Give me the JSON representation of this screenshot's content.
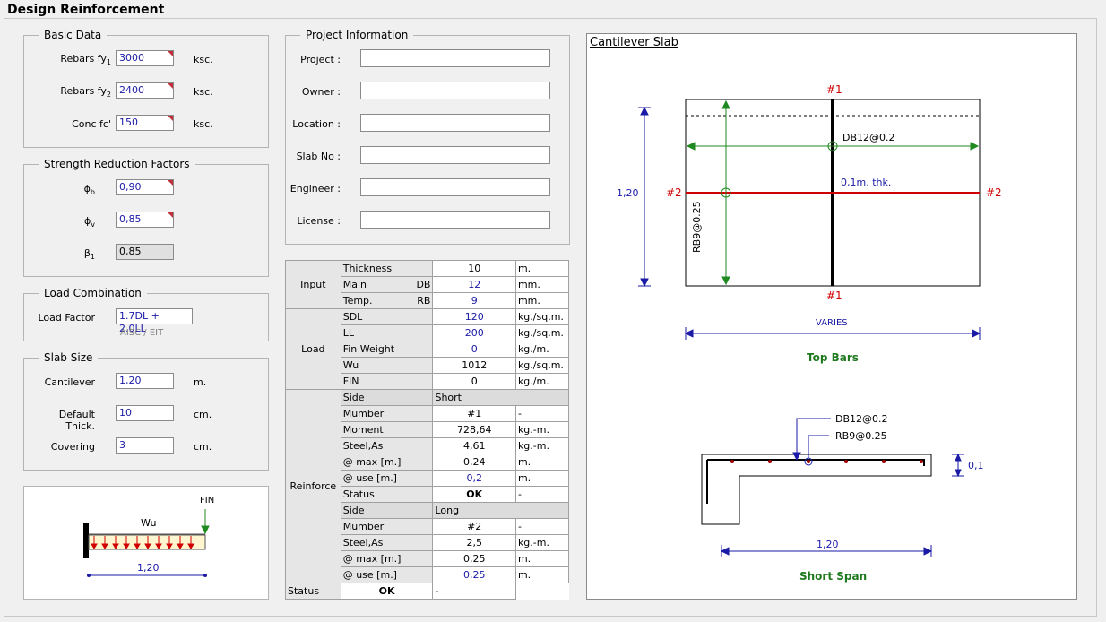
{
  "window_title": "Design Reinforcement",
  "basic_data": {
    "legend": "Basic Data",
    "rows": [
      {
        "label": "Rebars fy",
        "sub": "1",
        "value": "3000",
        "unit": "ksc."
      },
      {
        "label": "Rebars fy",
        "sub": "2",
        "value": "2400",
        "unit": "ksc."
      },
      {
        "label": "Conc fc'",
        "sub": "",
        "value": "150",
        "unit": "ksc."
      }
    ]
  },
  "strength": {
    "legend": "Strength Reduction Factors",
    "rows": [
      {
        "sym": "ϕ",
        "sub": "b",
        "value": "0,90"
      },
      {
        "sym": "ϕ",
        "sub": "v",
        "value": "0,85"
      },
      {
        "sym": "β",
        "sub": "1",
        "value": "0,85"
      }
    ]
  },
  "load_combination": {
    "legend": "Load Combination",
    "label": "Load Factor",
    "value": "1.7DL + 2.0LL",
    "note": "AISC / EIT"
  },
  "slab_size": {
    "legend": "Slab Size",
    "rows": [
      {
        "label": "Cantilever",
        "value": "1,20",
        "unit": "m."
      },
      {
        "label": "Default Thick.",
        "value": "10",
        "unit": "cm."
      },
      {
        "label": "Covering",
        "value": "3",
        "unit": "cm."
      }
    ]
  },
  "beam_sketch": {
    "load": "Wu",
    "point": "FIN",
    "span": "1,20"
  },
  "project": {
    "legend": "Project Information",
    "fields": [
      {
        "label": "Project :",
        "value": ""
      },
      {
        "label": "Owner :",
        "value": ""
      },
      {
        "label": "Location :",
        "value": ""
      },
      {
        "label": "Slab No :",
        "value": ""
      },
      {
        "label": "Engineer :",
        "value": ""
      },
      {
        "label": "License :",
        "value": ""
      }
    ]
  },
  "table": {
    "groups": {
      "input": "Input",
      "load": "Load",
      "reinforce": "Reinforce"
    },
    "input": [
      {
        "k": "Thickness",
        "k2": "",
        "v": "10",
        "u": "m.",
        "blue": false
      },
      {
        "k": "Main",
        "k2": "DB",
        "v": "12",
        "u": "mm.",
        "blue": true
      },
      {
        "k": "Temp.",
        "k2": "RB",
        "v": "9",
        "u": "mm.",
        "blue": true
      }
    ],
    "load": [
      {
        "k": "SDL",
        "v": "120",
        "u": "kg./sq.m.",
        "blue": true
      },
      {
        "k": "LL",
        "v": "200",
        "u": "kg./sq.m.",
        "blue": true
      },
      {
        "k": "Fin Weight",
        "v": "0",
        "u": "kg./m.",
        "blue": true
      },
      {
        "k": "Wu",
        "v": "1012",
        "u": "kg./sq.m.",
        "blue": false
      },
      {
        "k": "FIN",
        "v": "0",
        "u": "kg./m.",
        "blue": false
      }
    ],
    "short": {
      "side_label": "Side",
      "side_value": "Short",
      "rows": [
        {
          "k": "Mumber",
          "v": "#1",
          "u": "-",
          "blue": false,
          "bold": false
        },
        {
          "k": "Moment",
          "v": "728,64",
          "u": "kg.-m.",
          "blue": false,
          "bold": false
        },
        {
          "k": "Steel,As",
          "v": "4,61",
          "u": "kg.-m.",
          "blue": false,
          "bold": false
        },
        {
          "k": "@ max [m.]",
          "v": "0,24",
          "u": "m.",
          "blue": false,
          "bold": false
        },
        {
          "k": "@ use [m.]",
          "v": "0,2",
          "u": "m.",
          "blue": true,
          "bold": false
        },
        {
          "k": "Status",
          "v": "OK",
          "u": "-",
          "blue": false,
          "bold": true
        }
      ]
    },
    "long": {
      "side_label": "Side",
      "side_value": "Long",
      "rows": [
        {
          "k": "Mumber",
          "v": "#2",
          "u": "-",
          "blue": false,
          "bold": false
        },
        {
          "k": "Steel,As",
          "v": "2,5",
          "u": "kg.-m.",
          "blue": false,
          "bold": false
        },
        {
          "k": "@ max [m.]",
          "v": "0,25",
          "u": "m.",
          "blue": false,
          "bold": false
        },
        {
          "k": "@ use [m.]",
          "v": "0,25",
          "u": "m.",
          "blue": true,
          "bold": false
        },
        {
          "k": "Status",
          "v": "OK",
          "u": "-",
          "blue": false,
          "bold": true
        }
      ]
    }
  },
  "drawing": {
    "title": "Cantilever Slab",
    "mark1": "#1",
    "mark2": "#2",
    "main_bar": "DB12@0.2",
    "temp_bar": "RB9@0.25",
    "thickness": "0,1m. thk.",
    "cantilever": "1,20",
    "varies": "VARIES",
    "top_bars": "Top Bars",
    "section_db": "DB12@0.2",
    "section_rb": "RB9@0.25",
    "section_thk": "0,1",
    "section_span": "1,20",
    "short_span": "Short Span"
  }
}
